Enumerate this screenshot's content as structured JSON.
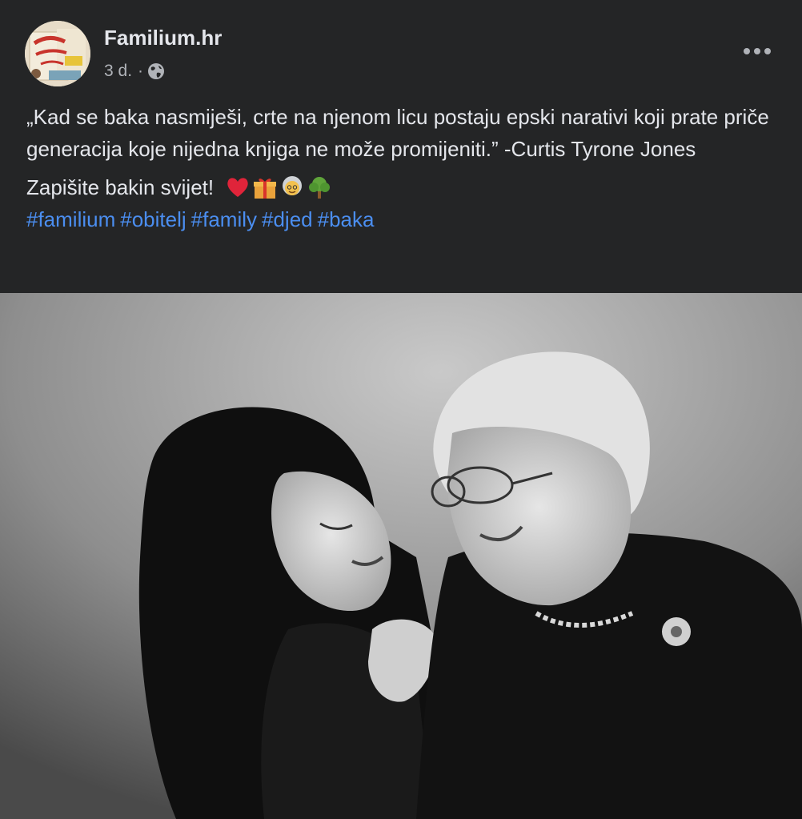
{
  "post": {
    "page_name": "Familium.hr",
    "time": "3 d.",
    "separator": "·",
    "privacy_icon": "globe-icon",
    "more_icon": "more-horizontal-icon",
    "quote": "„Kad se baka nasmiješi, crte na njenom licu postaju epski narativi koji prate priče generacija koje nijedna knjiga ne može promijeniti.” -Curtis Tyrone Jones",
    "cta": "Zapišite bakin svijet!",
    "emojis": [
      "red-heart-icon",
      "gift-icon",
      "grandmother-icon",
      "tree-icon"
    ],
    "hashtags": [
      "#familium",
      "#obitelj",
      "#family",
      "#djed",
      "#baka"
    ],
    "image_alt": "Black and white photo of a smiling young woman hugging her grandmother"
  },
  "colors": {
    "background": "#242526",
    "text": "#e4e6eb",
    "secondary_text": "#b0b3b8",
    "link": "#4b8ef0"
  }
}
